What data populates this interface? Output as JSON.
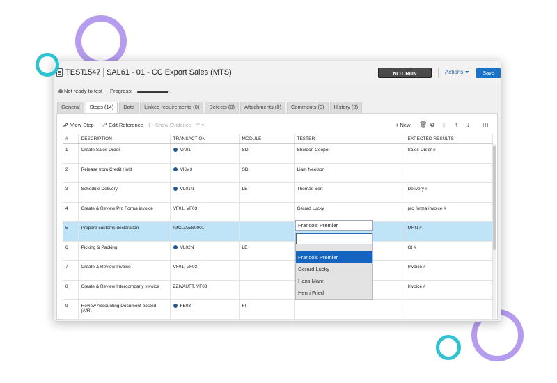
{
  "header": {
    "entity_type": "TEST",
    "entity_id": "1547",
    "title": "SAL61 - 01 - CC Export Sales (MTS)",
    "status": "NOT RUN",
    "actions_label": "Actions",
    "save_label": "Save"
  },
  "status_row": {
    "status_text": "Not ready to test",
    "progress_label": "Progress:",
    "progress": 0.93
  },
  "tabs": [
    {
      "label": "General"
    },
    {
      "label": "Steps (14)"
    },
    {
      "label": "Data"
    },
    {
      "label": "Linked requirements (0)"
    },
    {
      "label": "Defects (0)"
    },
    {
      "label": "Attachments (0)"
    },
    {
      "label": "Comments (0)"
    },
    {
      "label": "History (3)"
    }
  ],
  "toolbar": {
    "view_step": "View Step",
    "edit_reference": "Edit Reference",
    "show_evidence": "Show Evidence",
    "new": "New"
  },
  "table": {
    "columns": [
      "#",
      "DESCRIPTION",
      "TRANSACTION",
      "MODULE",
      "TESTER",
      "EXPECTED RESULTS"
    ],
    "rows": [
      {
        "num": "1",
        "description": "Create Sales Order",
        "transaction": "VA01",
        "sap_icon": true,
        "module": "SD",
        "tester": "Sheldon Cooper",
        "expected": "Sales Order #"
      },
      {
        "num": "2",
        "description": "Release from Credit Hold",
        "transaction": "VKM3",
        "sap_icon": true,
        "module": "SD",
        "tester": "Liam Neelson",
        "expected": ""
      },
      {
        "num": "3",
        "description": "Schedule Delivery",
        "transaction": "VL01N",
        "sap_icon": true,
        "module": "LE",
        "tester": "Thomas Bert",
        "expected": "Delivery #"
      },
      {
        "num": "4",
        "description": "Create & Review Pro Forma invoice",
        "transaction": "VF01, VF03",
        "sap_icon": false,
        "module": "",
        "tester": "Gerard Lucky",
        "expected": "pro forma invoice #"
      },
      {
        "num": "5",
        "description": "Prepare customs declaration",
        "transaction": "/MCL/AES0001",
        "sap_icon": false,
        "module": "",
        "tester": "",
        "expected": "MRN #"
      },
      {
        "num": "6",
        "description": "Picking & Packing",
        "transaction": "VL02N",
        "sap_icon": true,
        "module": "LE",
        "tester": "",
        "expected": "GI #"
      },
      {
        "num": "7",
        "description": "Create & Review Invoice",
        "transaction": "VF01, VF03",
        "sap_icon": false,
        "module": "",
        "tester": "",
        "expected": "Invoice #"
      },
      {
        "num": "8",
        "description": "Create & Review Intercompany Invoice",
        "transaction": "ZZIVAUFT, VF03",
        "sap_icon": false,
        "module": "",
        "tester": "",
        "expected": "Invoice #"
      },
      {
        "num": "9",
        "description": "Review Accounting Document posted (A/R)",
        "transaction": "FB03",
        "sap_icon": true,
        "module": "FI",
        "tester": "",
        "expected": ""
      }
    ]
  },
  "tester_editor": {
    "value": "Francois Premier",
    "options": [
      "Francois Premier",
      "Gerard Lucky",
      "Hans Mann",
      "Henri Fried"
    ]
  },
  "colors": {
    "accent": "#1a73c6",
    "selected_row": "#bfe3f7",
    "ring_purple": "#b69cef",
    "ring_teal": "#2fc3d2"
  }
}
